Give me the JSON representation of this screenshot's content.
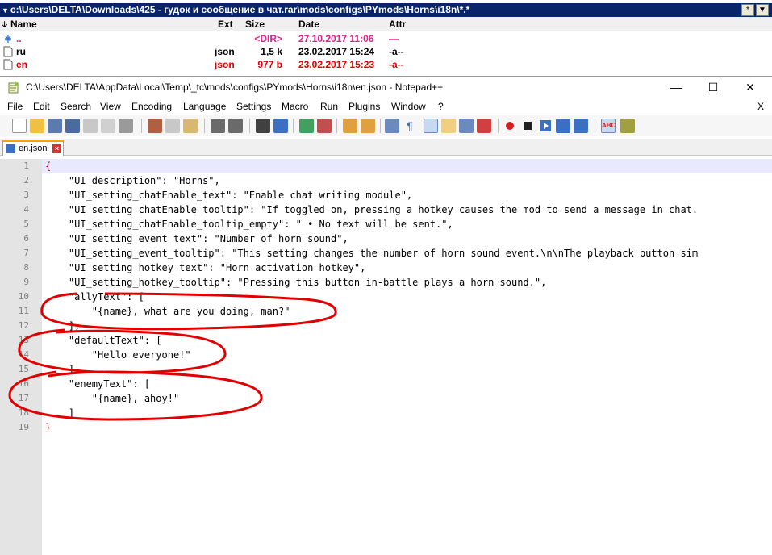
{
  "total_commander": {
    "path": "c:\\Users\\DELTA\\Downloads\\425 - гудок и сообщение в чат.rar\\mods\\configs\\PYmods\\Horns\\i18n\\*.*",
    "path_buttons": [
      "*",
      "▼"
    ],
    "columns": {
      "name": "Name",
      "ext": "Ext",
      "size": "Size",
      "date": "Date",
      "attr": "Attr"
    },
    "rows": [
      {
        "name": "..",
        "ext": "",
        "size": "<DIR>",
        "date": "27.10.2017 11:06",
        "attr": "—",
        "color": "#e0208c",
        "icon": "up-dir-icon"
      },
      {
        "name": "ru",
        "ext": "json",
        "size": "1,5 k",
        "date": "23.02.2017 15:24",
        "attr": "-a--",
        "color": "#000000",
        "icon": "file-icon"
      },
      {
        "name": "en",
        "ext": "json",
        "size": "977 b",
        "date": "23.02.2017 15:23",
        "attr": "-a--",
        "color": "#e00000",
        "icon": "file-icon"
      }
    ]
  },
  "notepad": {
    "title": "C:\\Users\\DELTA\\AppData\\Local\\Temp\\_tc\\mods\\configs\\PYmods\\Horns\\i18n\\en.json - Notepad++",
    "window_buttons": {
      "minimize": "—",
      "maximize": "☐",
      "close": "✕"
    },
    "menu": [
      "File",
      "Edit",
      "Search",
      "View",
      "Encoding",
      "Language",
      "Settings",
      "Macro",
      "Run",
      "Plugins",
      "Window",
      "?"
    ],
    "menu_close": "X",
    "tab": {
      "label": "en.json",
      "close": "×"
    },
    "lines": [
      {
        "no": "1",
        "text": "{"
      },
      {
        "no": "2",
        "text": "    \"UI_description\": \"Horns\","
      },
      {
        "no": "3",
        "text": "    \"UI_setting_chatEnable_text\": \"Enable chat writing module\","
      },
      {
        "no": "4",
        "text": "    \"UI_setting_chatEnable_tooltip\": \"If toggled on, pressing a hotkey causes the mod to send a message in chat."
      },
      {
        "no": "5",
        "text": "    \"UI_setting_chatEnable_tooltip_empty\": \" • No text will be sent.\","
      },
      {
        "no": "6",
        "text": "    \"UI_setting_event_text\": \"Number of horn sound\","
      },
      {
        "no": "7",
        "text": "    \"UI_setting_event_tooltip\": \"This setting changes the number of horn sound event.\\n\\nThe playback button sim"
      },
      {
        "no": "8",
        "text": "    \"UI_setting_hotkey_text\": \"Horn activation hotkey\","
      },
      {
        "no": "9",
        "text": "    \"UI_setting_hotkey_tooltip\": \"Pressing this button in-battle plays a horn sound.\","
      },
      {
        "no": "10",
        "text": "    \"allyText\": ["
      },
      {
        "no": "11",
        "text": "        \"{name}, what are you doing, man?\""
      },
      {
        "no": "12",
        "text": "    ],"
      },
      {
        "no": "13",
        "text": "    \"defaultText\": ["
      },
      {
        "no": "14",
        "text": "        \"Hello everyone!\""
      },
      {
        "no": "15",
        "text": "    ],"
      },
      {
        "no": "16",
        "text": "    \"enemyText\": ["
      },
      {
        "no": "17",
        "text": "        \"{name}, ahoy!\""
      },
      {
        "no": "18",
        "text": "    ]"
      },
      {
        "no": "19",
        "text": "}"
      }
    ]
  },
  "colors": {
    "annotation": "#e00000",
    "path_bar": "#0a246a",
    "highlight": "#e0208c"
  }
}
